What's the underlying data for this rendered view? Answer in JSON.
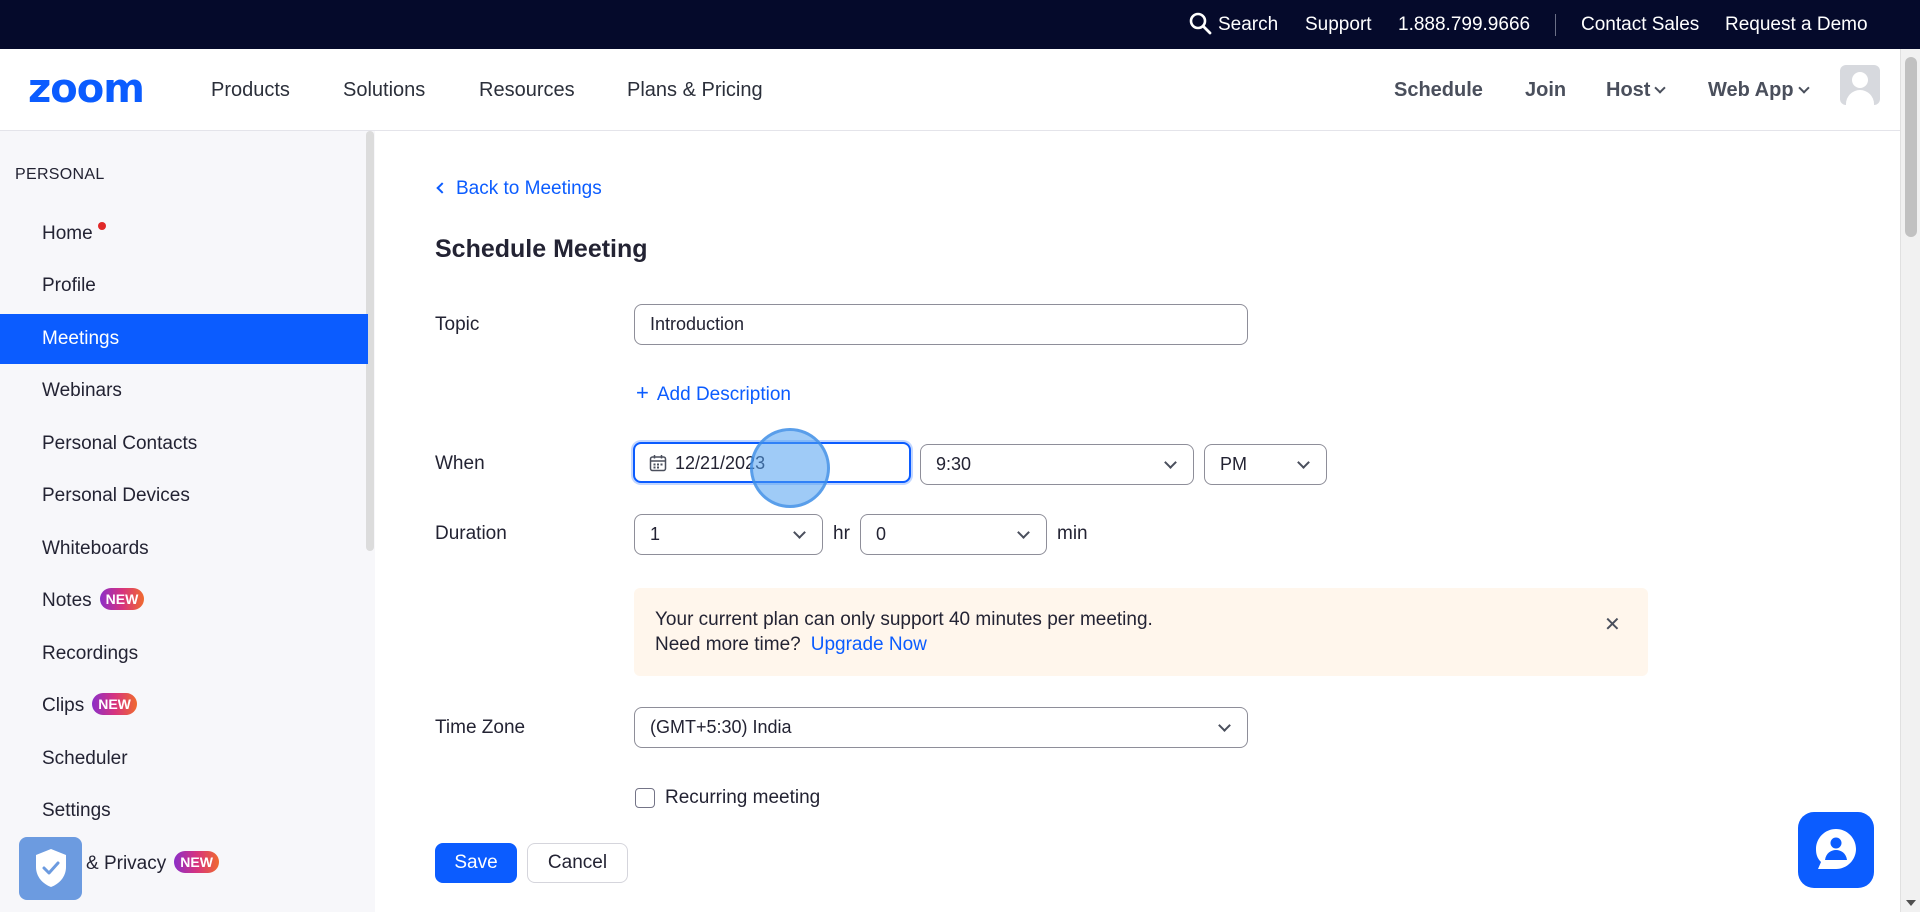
{
  "topbar": {
    "search_label": "Search",
    "support_label": "Support",
    "phone": "1.888.799.9666",
    "contact_sales": "Contact Sales",
    "request_demo": "Request a Demo"
  },
  "nav": {
    "logo": "zoom",
    "products": "Products",
    "solutions": "Solutions",
    "resources": "Resources",
    "plans_pricing": "Plans & Pricing",
    "schedule": "Schedule",
    "join": "Join",
    "host": "Host",
    "web_app": "Web App"
  },
  "sidebar": {
    "heading": "PERSONAL",
    "items": [
      {
        "label": "Home"
      },
      {
        "label": "Profile"
      },
      {
        "label": "Meetings"
      },
      {
        "label": "Webinars"
      },
      {
        "label": "Personal Contacts"
      },
      {
        "label": "Personal Devices"
      },
      {
        "label": "Whiteboards"
      },
      {
        "label": "Notes",
        "badge": "NEW"
      },
      {
        "label": "Recordings"
      },
      {
        "label": "Clips",
        "badge": "NEW"
      },
      {
        "label": "Scheduler"
      },
      {
        "label": "Settings"
      },
      {
        "label": "& Privacy",
        "badge": "NEW"
      }
    ]
  },
  "content": {
    "back_link": "Back to Meetings",
    "title": "Schedule Meeting",
    "topic_label": "Topic",
    "topic_value": "Introduction",
    "add_description": "Add Description",
    "when_label": "When",
    "date_value": "12/21/2023",
    "time_value": "9:30",
    "ampm_value": "PM",
    "duration_label": "Duration",
    "duration_hours": "1",
    "hr_unit": "hr",
    "duration_minutes": "0",
    "min_unit": "min",
    "notice_line1": "Your current plan can only support 40 minutes per meeting.",
    "notice_line2": "Need more time?",
    "upgrade_now": "Upgrade Now",
    "timezone_label": "Time Zone",
    "timezone_value": "(GMT+5:30) India",
    "recurring_label": "Recurring meeting",
    "save": "Save",
    "cancel": "Cancel"
  },
  "colors": {
    "brand": "#0b5cff",
    "topbar_bg": "#050a2b",
    "notice_bg": "#fff6ec"
  }
}
